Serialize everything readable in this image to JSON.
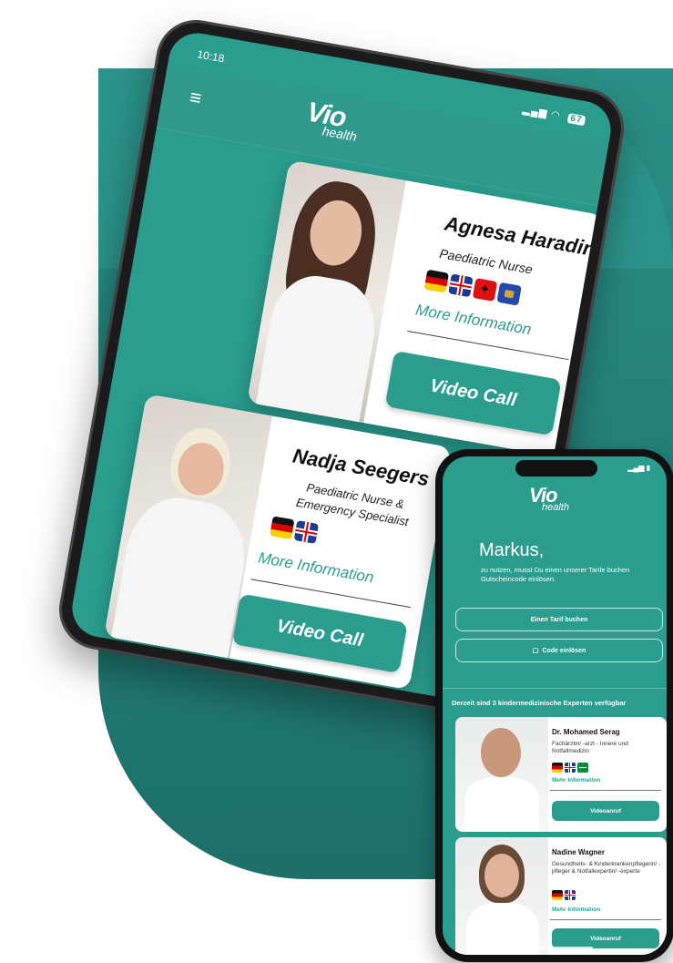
{
  "tablet": {
    "time": "10:18",
    "battery": "67",
    "logo": {
      "mark": "Vio",
      "sub": "health"
    },
    "doctors": [
      {
        "name": "Agnesa Haradinaj",
        "role": "Paediatric Nurse",
        "flags": [
          "de",
          "uk",
          "al",
          "xk"
        ],
        "more": "More Information",
        "button": "Video Call"
      },
      {
        "name": "Nadja  Seegers",
        "role": "Paediatric Nurse  &\nEmergency Specialist",
        "flags": [
          "de",
          "uk"
        ],
        "more": "More Information",
        "button": "Video Call"
      }
    ]
  },
  "phone": {
    "logo": {
      "mark": "Vio",
      "sub": "health"
    },
    "greeting": "Markus,",
    "intro": "zu nutzen, musst Du einen unserer Tarife buchen Gutscheincode einlösen.",
    "buttons": {
      "tariff": "Einen Tarif buchen",
      "code": "Code einlösen"
    },
    "available": "Derzeit sind 3 kindermedizinische Experten verfügbar",
    "doctors": [
      {
        "name": "Dr. Mohamed Serag",
        "role": "Fachärztin/ -arzt - Innere und Notfallmedizin",
        "flags": [
          "de",
          "uk",
          "sa"
        ],
        "more": "Mehr Information",
        "button": "Videoanruf"
      },
      {
        "name": "Nadine Wagner",
        "role": "Gesundheits- & Kinderkrankenpflegerin/ -pfleger & Notfallexpertin/ -experte",
        "flags": [
          "de",
          "uk"
        ],
        "more": "Mehr Information",
        "button": "Videoanruf"
      }
    ]
  },
  "colors": {
    "brand": "#2a9d8f",
    "brand_dark": "#1d6f69"
  }
}
